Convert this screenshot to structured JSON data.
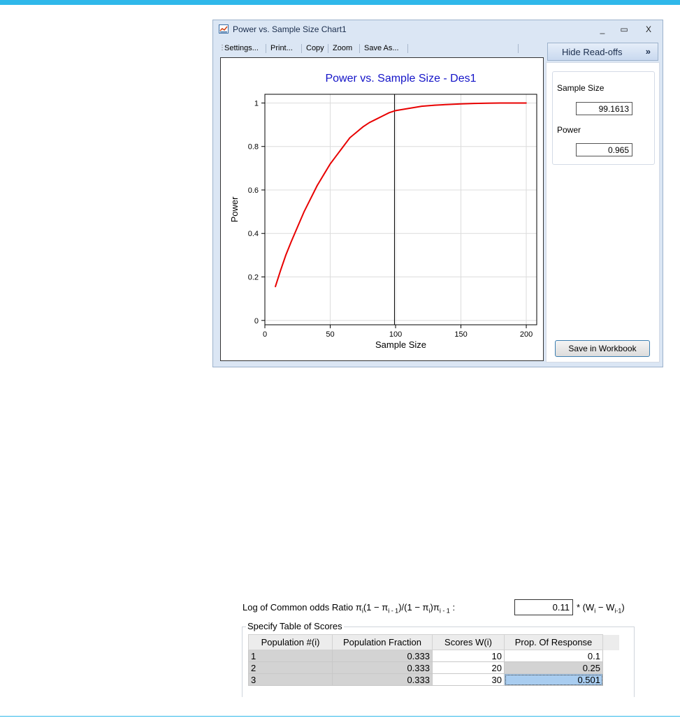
{
  "window": {
    "title": "Power vs. Sample Size Chart1",
    "controls": {
      "minimize": "_",
      "maximize": "▭",
      "close": "X"
    }
  },
  "toolbar": {
    "items": [
      "Settings...",
      "Print...",
      "Copy",
      "Zoom",
      "Save As..."
    ]
  },
  "side_panel": {
    "hide_button": "Hide Read-offs",
    "hide_chevron": "»",
    "sample_size_label": "Sample Size",
    "sample_size_value": "99.1613",
    "power_label": "Power",
    "power_value": "0.965",
    "save_button": "Save in Workbook"
  },
  "chart_data": {
    "type": "line",
    "title": "Power vs. Sample Size - Des1",
    "xlabel": "Sample Size",
    "ylabel": "Power",
    "xlim": [
      0,
      208
    ],
    "ylim": [
      -0.02,
      1.04
    ],
    "x_ticks": [
      0,
      50,
      100,
      150,
      200
    ],
    "y_ticks": [
      0,
      0.2,
      0.4,
      0.6,
      0.8,
      1
    ],
    "y_tick_labels": [
      "0",
      "0.2",
      "0.4",
      "0.6",
      "0.8",
      "1"
    ],
    "grid": true,
    "series_color": "#e80000",
    "readoff_x": 99.1613,
    "series": [
      {
        "x": [
          8,
          12,
          16,
          20,
          25,
          30,
          35,
          40,
          45,
          50,
          55,
          60,
          65,
          70,
          75,
          80,
          85,
          90,
          95,
          100,
          110,
          120,
          130,
          140,
          150,
          160,
          170,
          180,
          190,
          200
        ],
        "y": [
          0.155,
          0.23,
          0.3,
          0.36,
          0.43,
          0.5,
          0.56,
          0.62,
          0.67,
          0.72,
          0.76,
          0.8,
          0.84,
          0.865,
          0.89,
          0.91,
          0.925,
          0.94,
          0.955,
          0.965,
          0.975,
          0.985,
          0.99,
          0.993,
          0.996,
          0.998,
          0.999,
          1.0,
          1.0,
          1.0
        ]
      }
    ]
  },
  "odds": {
    "label_prefix": "Log of Common odds Ratio π",
    "label_rest": "(1 − π",
    "value": "0.11",
    "suffix_prefix": "* (W",
    "suffix_mid": " − W",
    "suffix_end": ")"
  },
  "scores": {
    "legend": "Specify Table of Scores",
    "headers": [
      "Population #(i)",
      "Population Fraction",
      "Scores W(i)",
      "Prop. Of Response"
    ],
    "rows": [
      [
        "1",
        "0.333",
        "10",
        "0.1"
      ],
      [
        "2",
        "0.333",
        "20",
        "0.25"
      ],
      [
        "3",
        "0.333",
        "30",
        "0.501"
      ]
    ]
  }
}
